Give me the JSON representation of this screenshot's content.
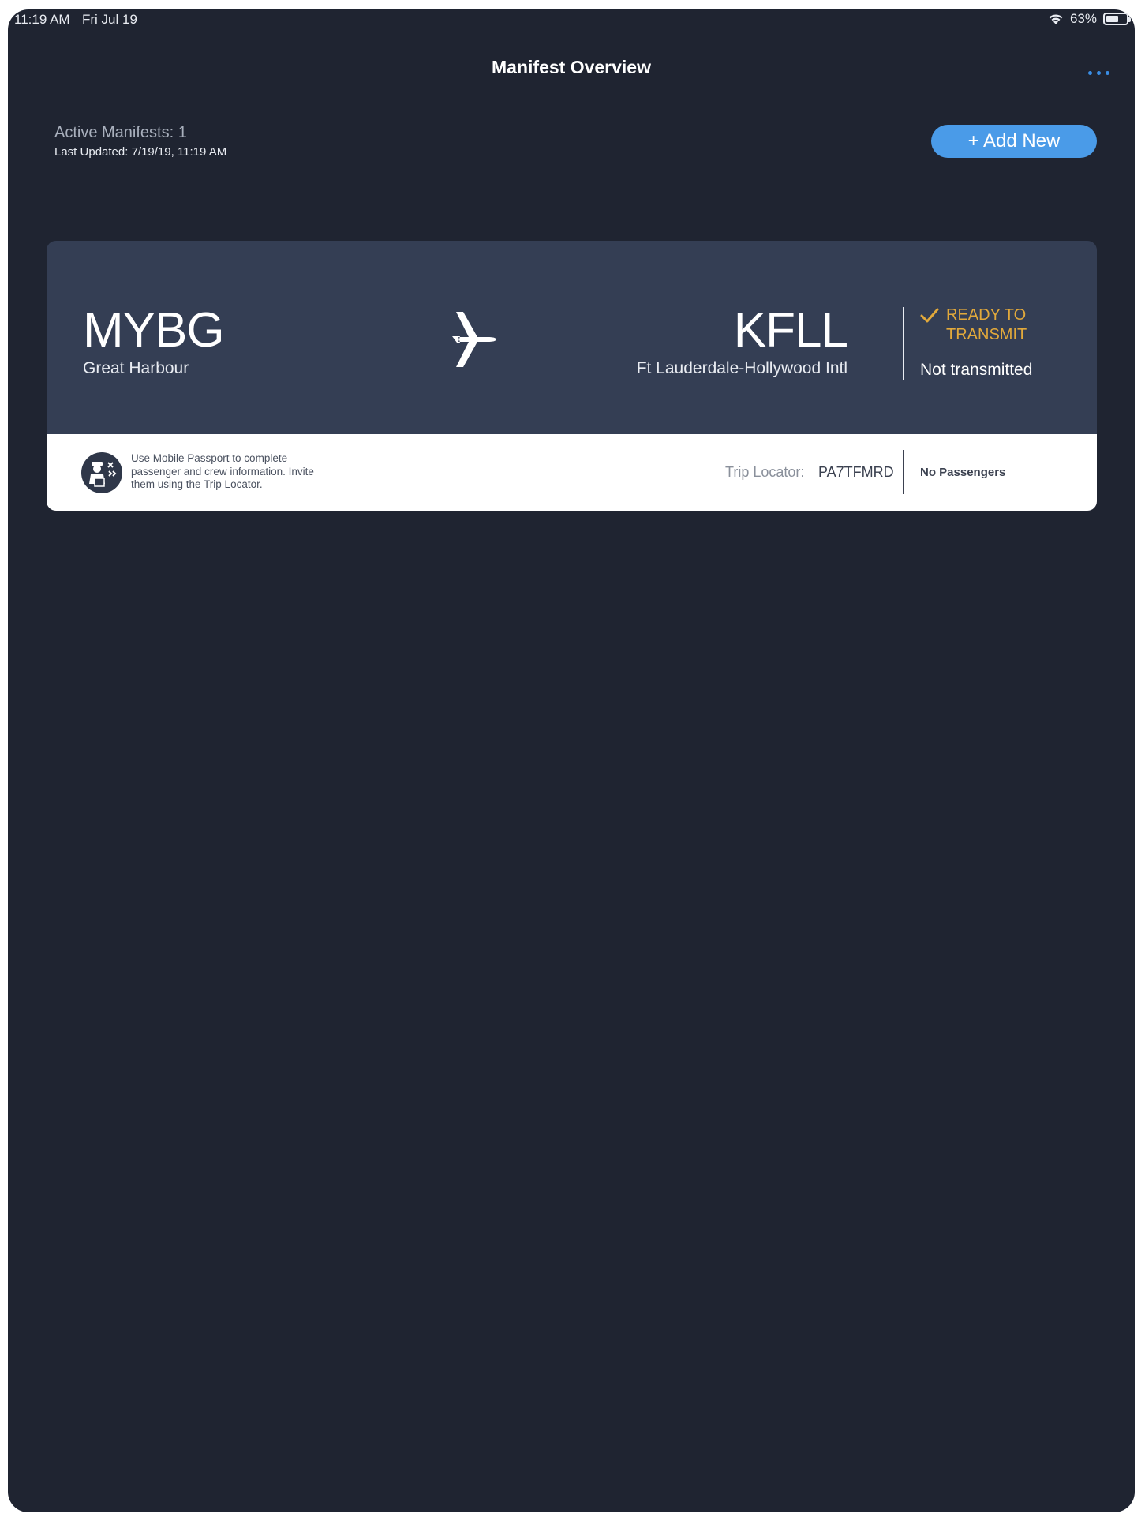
{
  "status_bar": {
    "time": "11:19 AM",
    "date": "Fri Jul 19",
    "battery": "63%",
    "battery_level": 0.63,
    "icons": [
      "wifi-icon",
      "battery-icon"
    ]
  },
  "nav": {
    "title": "Manifest Overview",
    "more_icon": "ellipsis-icon"
  },
  "summary": {
    "active_manifests": "Active Manifests: 1",
    "last_updated": "Last Updated: 7/19/19, 11:19 AM"
  },
  "add_button": {
    "label": "+ Add New"
  },
  "manifest": {
    "origin_code": "MYBG",
    "origin_name": "Great Harbour",
    "destination_code": "KFLL",
    "destination_name": "Ft Lauderdale-Hollywood Intl",
    "ready_label": "READY TO TRANSMIT",
    "transmit_status": "Not transmitted",
    "passport_text": "Use Mobile Passport to complete passenger and crew information. Invite them using the Trip Locator.",
    "trip_locator_label": "Trip Locator:",
    "trip_locator_value": "PA7TFMRD",
    "passenger_status": "No Passengers"
  },
  "colors": {
    "background": "#1f2431",
    "card": "#343e54",
    "accent": "#4a9be8",
    "ready": "#e2a93b"
  }
}
